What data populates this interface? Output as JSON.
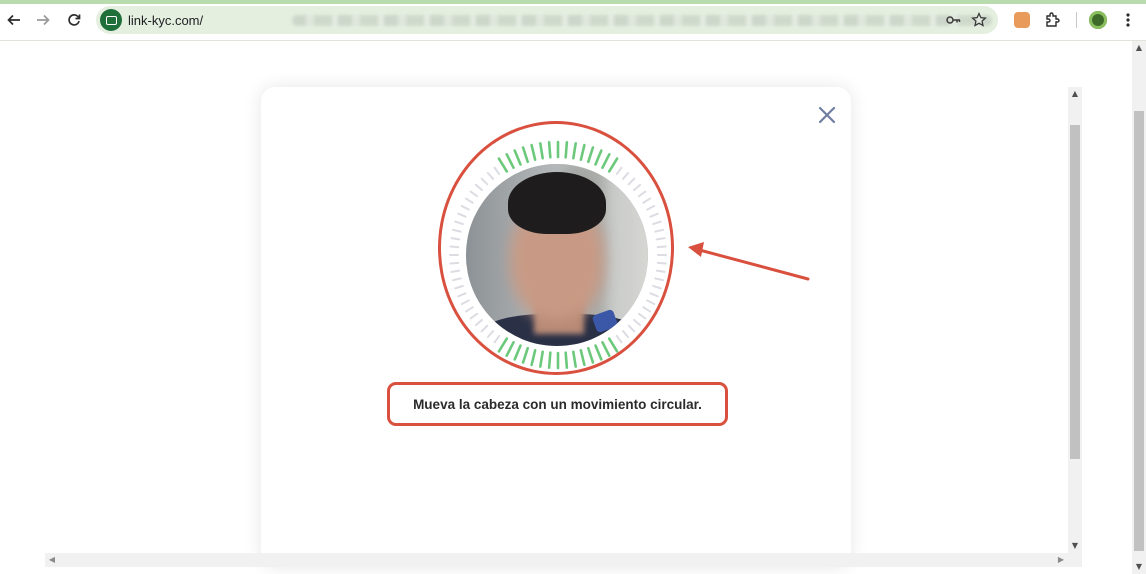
{
  "browser": {
    "url_host": "link-kyc.com/",
    "icons": {
      "back": "arrow-left-icon",
      "forward": "arrow-right-icon",
      "reload": "reload-icon",
      "site_info": "camera-icon",
      "password": "key-icon",
      "bookmark": "star-icon",
      "extension_1": "fox-extension-icon",
      "extensions": "puzzle-icon",
      "profile": "profile-icon",
      "menu": "kebab-menu-icon"
    }
  },
  "modal": {
    "close_icon": "close-icon",
    "instruction": "Mueva la cabeza con un movimiento circular.",
    "progress_ring": {
      "complete_color": "#6cc97c",
      "pending_color": "#dcdde3"
    }
  },
  "annotations": {
    "color": "#d9503f"
  },
  "colors": {
    "toolbar_accent": "#b9dcae",
    "omnibox_bg": "#e5efe0",
    "close_icon": "#6f7ea0"
  }
}
